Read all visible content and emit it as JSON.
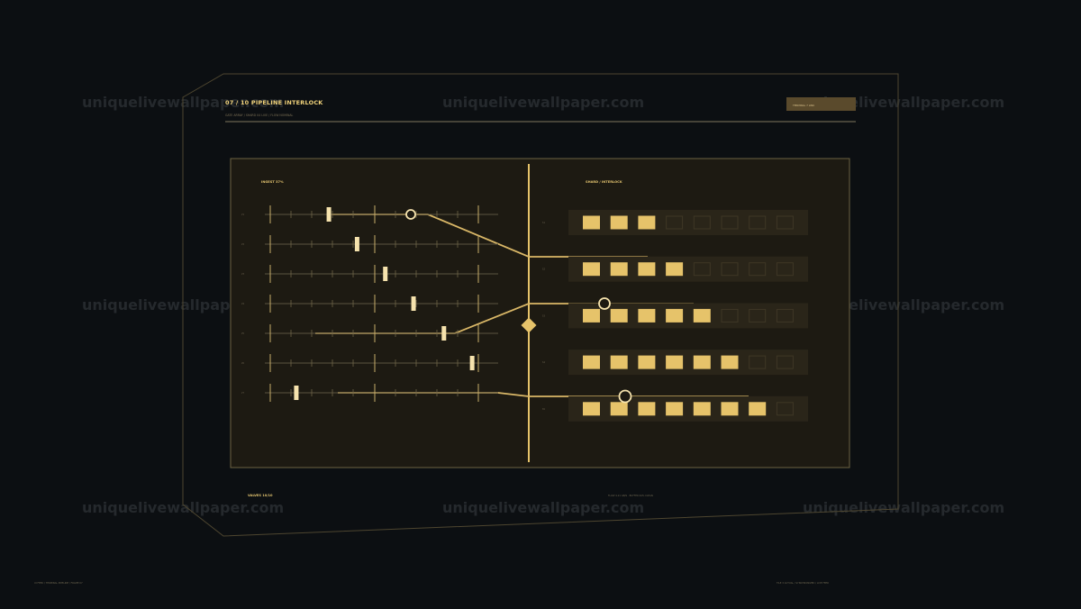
{
  "header": {
    "title": "07 / 10  PIPELINE INTERLOCK",
    "subtitle": "GATE ARRAY / SHARD 04 LIVE / FLOW NOMINAL",
    "badge": "TERMINAL 7 LINK"
  },
  "panel": {
    "left_label": "INGEST 37%",
    "right_label": "SHARD / INTERLOCK"
  },
  "footer": {
    "left": "VALVES 10/10",
    "center": "FLOW 4.21 GB/S  ·  BUFFER 64% CLEAN",
    "bottom_left": "UI FEED / TERMINAL PIPELINE / FRAME 07",
    "bottom_right": "TILE 3 ACTUAL / SYNCHRONIZED / LIVE FEED"
  },
  "watermark": "uniquelivewallpaper.com",
  "colors": {
    "background": "#0c0f12",
    "panel": "#1d1a12",
    "accent": "#e6c36a",
    "accent_light": "#f6e3ad",
    "frame_line": "#4e4630",
    "slot_empty": "#2a2519"
  },
  "valves": [
    {
      "label": "V1",
      "position": 0.27
    },
    {
      "label": "V2",
      "position": 0.4
    },
    {
      "label": "V3",
      "position": 0.53
    },
    {
      "label": "V4",
      "position": 0.66
    },
    {
      "label": "V5",
      "position": 0.8
    },
    {
      "label": "V6",
      "position": 0.93
    },
    {
      "label": "V7",
      "position": 0.12
    }
  ],
  "shards": [
    {
      "label": "S1",
      "filled": 3,
      "total": 8
    },
    {
      "label": "S2",
      "filled": 4,
      "total": 8
    },
    {
      "label": "S3",
      "filled": 5,
      "total": 8
    },
    {
      "label": "S4",
      "filled": 6,
      "total": 8
    },
    {
      "label": "S5",
      "filled": 7,
      "total": 8
    }
  ]
}
